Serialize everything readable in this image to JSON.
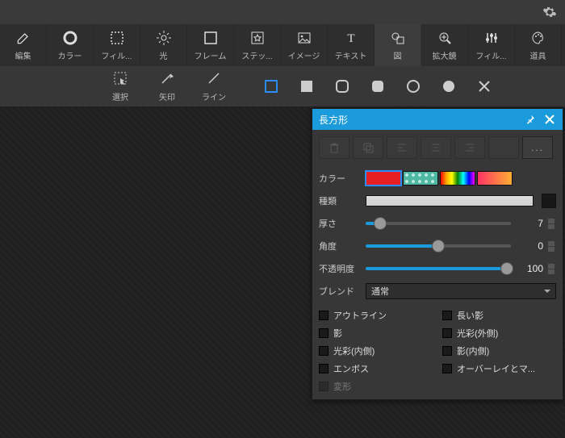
{
  "menubar": {
    "settings_icon": "settings"
  },
  "toolbar": {
    "items": [
      {
        "id": "edit",
        "label": "編集"
      },
      {
        "id": "color",
        "label": "カラー"
      },
      {
        "id": "filter",
        "label": "フィル..."
      },
      {
        "id": "light",
        "label": "光"
      },
      {
        "id": "frame",
        "label": "フレーム"
      },
      {
        "id": "sticker",
        "label": "ステッ..."
      },
      {
        "id": "image",
        "label": "イメージ"
      },
      {
        "id": "text",
        "label": "テキスト"
      },
      {
        "id": "shape",
        "label": "図"
      },
      {
        "id": "magnify",
        "label": "拡大鏡"
      },
      {
        "id": "filter2",
        "label": "フィル..."
      },
      {
        "id": "tools",
        "label": "道具"
      }
    ],
    "selected": "shape"
  },
  "subbar": {
    "tools": [
      {
        "id": "select",
        "label": "選択"
      },
      {
        "id": "arrow",
        "label": "矢印"
      },
      {
        "id": "line",
        "label": "ライン"
      }
    ],
    "shapes": [
      "rect-outline",
      "rect-fill",
      "roundrect-outline",
      "roundrect-fill",
      "circle-outline",
      "circle-fill",
      "close"
    ],
    "selected_shape": "rect-outline"
  },
  "panel": {
    "title": "長方形",
    "pin_icon": "pin",
    "close_icon": "close",
    "action_icons": [
      "delete",
      "duplicate",
      "align-left",
      "align-center",
      "align-right",
      "blank",
      "more"
    ],
    "color_label": "カラー",
    "color_selected": 0,
    "type_label": "種類",
    "thickness_label": "厚さ",
    "thickness_value": "7",
    "angle_label": "角度",
    "angle_value": "0",
    "opacity_label": "不透明度",
    "opacity_value": "100",
    "blend_label": "ブレンド",
    "blend_value": "通常",
    "checkboxes": [
      {
        "label": "アウトライン",
        "checked": false
      },
      {
        "label": "長い影",
        "checked": false
      },
      {
        "label": "影",
        "checked": false
      },
      {
        "label": "光彩(外側)",
        "checked": false
      },
      {
        "label": "光彩(内側)",
        "checked": false
      },
      {
        "label": "影(内側)",
        "checked": false
      },
      {
        "label": "エンボス",
        "checked": false
      },
      {
        "label": "オーバーレイとマ...",
        "checked": false
      },
      {
        "label": "変形",
        "checked": false,
        "disabled": true
      }
    ]
  }
}
